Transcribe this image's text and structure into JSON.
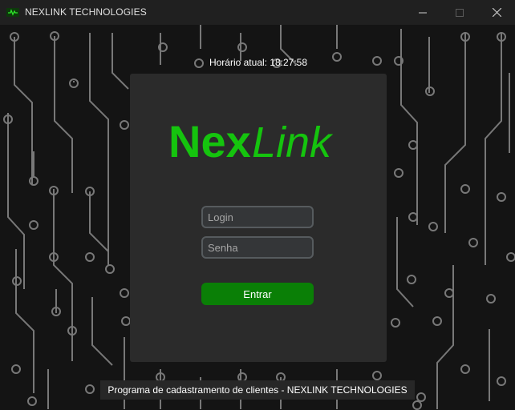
{
  "window": {
    "title": "NEXLINK TECHNOLOGIES",
    "controls": [
      "minimize",
      "maximize",
      "close"
    ]
  },
  "clock": {
    "text": "Horário atual: 18:27:58"
  },
  "logo": {
    "part1": "Nex",
    "part2": "Link",
    "color": "#15c40e"
  },
  "form": {
    "login_placeholder": "Login",
    "password_placeholder": "Senha",
    "submit_label": "Entrar"
  },
  "footer": {
    "text": "Programa de cadastramento de clientes - NEXLINK TECHNOLOGIES"
  },
  "colors": {
    "accent": "#0a7f06",
    "logo_green": "#15c40e",
    "card_bg": "#2b2b2b",
    "window_bg": "#141414",
    "circuit": "#8a8a8a"
  }
}
